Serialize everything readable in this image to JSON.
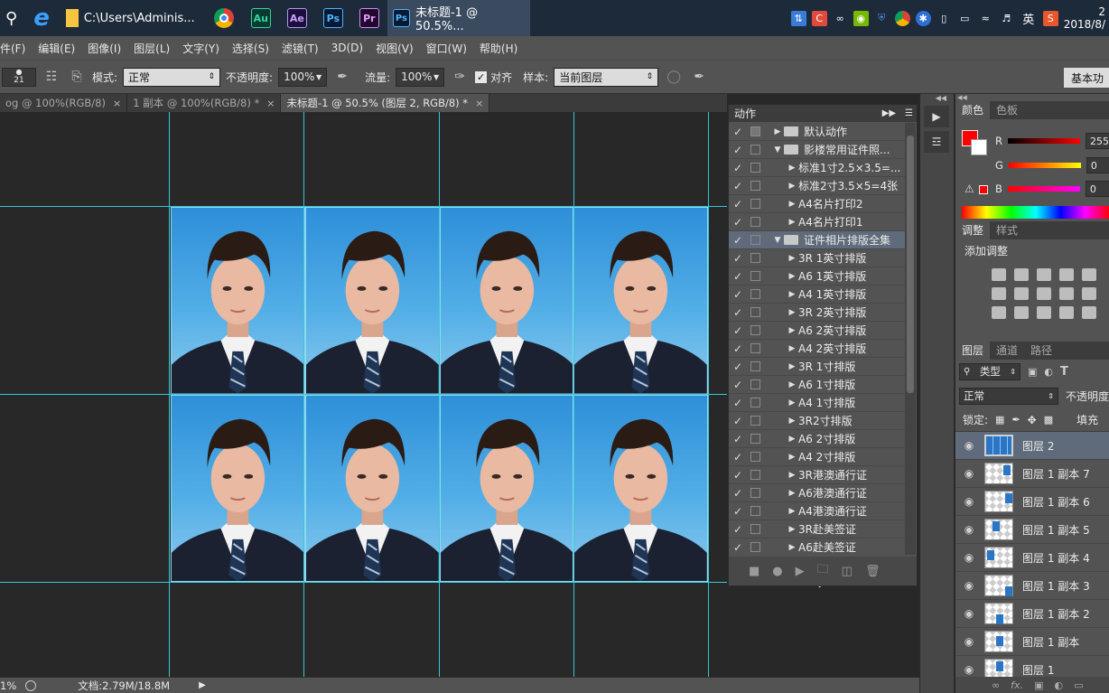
{
  "taskbar": {
    "search_icon": "search-icon",
    "folder_path": "C:\\Users\\Adminis...",
    "apps": [
      "Au",
      "Ae",
      "Ps",
      "Pr"
    ],
    "active_window_label": "未标题-1 @ 50.5%...",
    "ime_label": "英",
    "clock_line1": "2",
    "clock_line2": "2018/8/"
  },
  "menu": [
    "件(F)",
    "编辑(E)",
    "图像(I)",
    "图层(L)",
    "文字(Y)",
    "选择(S)",
    "滤镜(T)",
    "3D(D)",
    "视图(V)",
    "窗口(W)",
    "帮助(H)"
  ],
  "options": {
    "brush_size": "21",
    "mode_label": "模式:",
    "mode_value": "正常",
    "opacity_label": "不透明度:",
    "opacity_value": "100%",
    "flow_label": "流量:",
    "flow_value": "100%",
    "align_label": "对齐",
    "sample_label": "样本:",
    "sample_value": "当前图层",
    "workspace": "基本功"
  },
  "doc_tabs": [
    {
      "label": "og @ 100%(RGB/8)",
      "active": false
    },
    {
      "label": "1 副本 @ 100%(RGB/8) *",
      "active": false
    },
    {
      "label": "未标题-1 @ 50.5% (图层 2, RGB/8) *",
      "active": true
    }
  ],
  "status": {
    "zoom": "1%",
    "doc_info": "文档:2.79M/18.8M"
  },
  "actions_panel": {
    "title": "动作",
    "items": [
      {
        "label": "默认动作",
        "level": 0,
        "folder": true,
        "expanded": false
      },
      {
        "label": "影楼常用证件照...",
        "level": 0,
        "folder": true,
        "expanded": true
      },
      {
        "label": "标准1寸2.5×3.5=...",
        "level": 1,
        "folder": false
      },
      {
        "label": "标准2寸3.5×5=4张",
        "level": 1,
        "folder": false
      },
      {
        "label": "A4名片打印2",
        "level": 1,
        "folder": false
      },
      {
        "label": "A4名片打印1",
        "level": 1,
        "folder": false
      },
      {
        "label": "证件相片排版全集",
        "level": 0,
        "folder": true,
        "expanded": true,
        "selected": true
      },
      {
        "label": "3R 1英寸排版",
        "level": 1,
        "folder": false
      },
      {
        "label": "A6 1英寸排版",
        "level": 1,
        "folder": false
      },
      {
        "label": "A4 1英寸排版",
        "level": 1,
        "folder": false
      },
      {
        "label": "3R 2英寸排版",
        "level": 1,
        "folder": false
      },
      {
        "label": "A6 2英寸排版",
        "level": 1,
        "folder": false
      },
      {
        "label": "A4 2英寸排版",
        "level": 1,
        "folder": false
      },
      {
        "label": "3R 1寸排版",
        "level": 1,
        "folder": false
      },
      {
        "label": "A6 1寸排版",
        "level": 1,
        "folder": false
      },
      {
        "label": "A4 1寸排版",
        "level": 1,
        "folder": false
      },
      {
        "label": "3R2寸排版",
        "level": 1,
        "folder": false
      },
      {
        "label": "A6 2寸排版",
        "level": 1,
        "folder": false
      },
      {
        "label": "A4 2寸排版",
        "level": 1,
        "folder": false
      },
      {
        "label": "3R港澳通行证",
        "level": 1,
        "folder": false
      },
      {
        "label": "A6港澳通行证",
        "level": 1,
        "folder": false
      },
      {
        "label": "A4港澳通行证",
        "level": 1,
        "folder": false
      },
      {
        "label": "3R赴美签证",
        "level": 1,
        "folder": false
      },
      {
        "label": "A6赴美签证",
        "level": 1,
        "folder": false
      }
    ]
  },
  "color_panel": {
    "tabs": [
      "颜色",
      "色板"
    ],
    "r_label": "R",
    "r_value": "255",
    "g_label": "G",
    "g_value": "0",
    "b_label": "B",
    "b_value": "0",
    "foreground": "#ff0000",
    "background": "#ffffff"
  },
  "adjust_panel": {
    "tabs": [
      "调整",
      "样式"
    ],
    "title": "添加调整"
  },
  "layers_panel": {
    "tabs": [
      "图层",
      "通道",
      "路径"
    ],
    "filter_label": "类型",
    "blend_mode": "正常",
    "opacity_label": "不透明度",
    "lock_label": "锁定:",
    "fill_label": "填充",
    "layers": [
      {
        "name": "图层 2",
        "selected": true
      },
      {
        "name": "图层 1 副本 7",
        "selected": false
      },
      {
        "name": "图层 1 副本 6",
        "selected": false
      },
      {
        "name": "图层 1 副本 5",
        "selected": false
      },
      {
        "name": "图层 1 副本 4",
        "selected": false
      },
      {
        "name": "图层 1 副本 3",
        "selected": false
      },
      {
        "name": "图层 1 副本 2",
        "selected": false
      },
      {
        "name": "图层 1 副本",
        "selected": false
      },
      {
        "name": "图层 1",
        "selected": false
      }
    ]
  }
}
